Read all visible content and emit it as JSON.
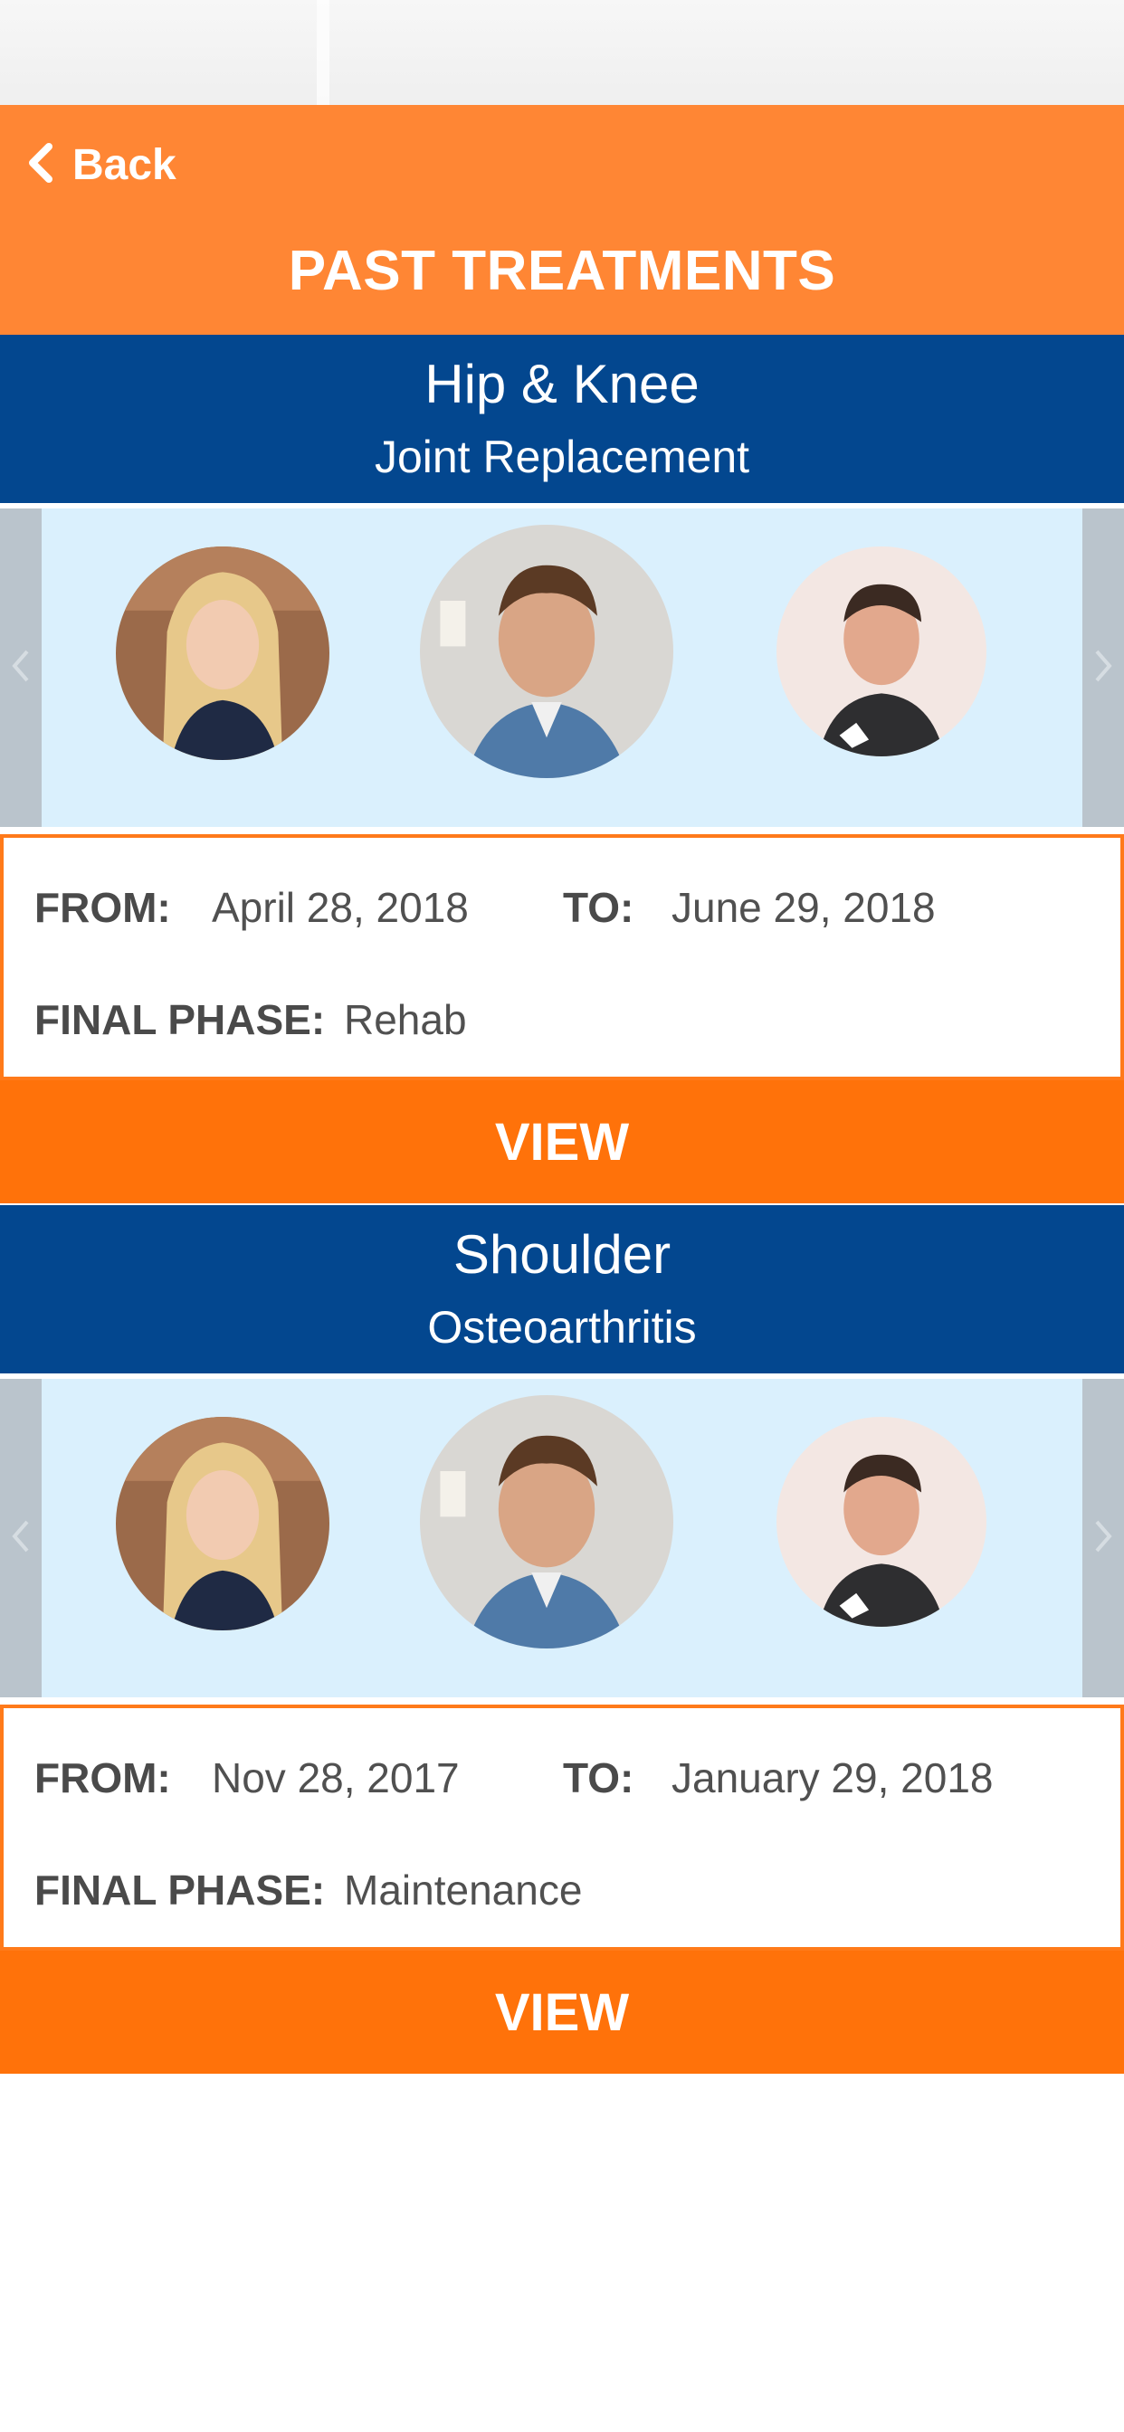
{
  "header": {
    "back_label": "Back",
    "title": "PAST TREATMENTS"
  },
  "treatments": [
    {
      "title": "Hip & Knee",
      "subtitle": "Joint Replacement",
      "from_label": "FROM:",
      "from_value": "April 28, 2018",
      "to_label": "TO:",
      "to_value": "June 29, 2018",
      "phase_label": "FINAL PHASE:",
      "phase_value": "Rehab",
      "view_label": "VIEW"
    },
    {
      "title": "Shoulder",
      "subtitle": "Osteoarthritis",
      "from_label": "FROM:",
      "from_value": "Nov 28, 2017",
      "to_label": "TO:",
      "to_value": "January 29, 2018",
      "phase_label": "FINAL PHASE:",
      "phase_value": "Maintenance",
      "view_label": "VIEW"
    }
  ],
  "colors": {
    "header_orange": "#ff8634",
    "title_blue": "#03478f",
    "carousel_bg": "#daf0fd",
    "button_orange": "#ff720a"
  },
  "icons": {
    "back": "chevron-left-icon",
    "carousel_prev": "chevron-left-icon",
    "carousel_next": "chevron-right-icon"
  }
}
